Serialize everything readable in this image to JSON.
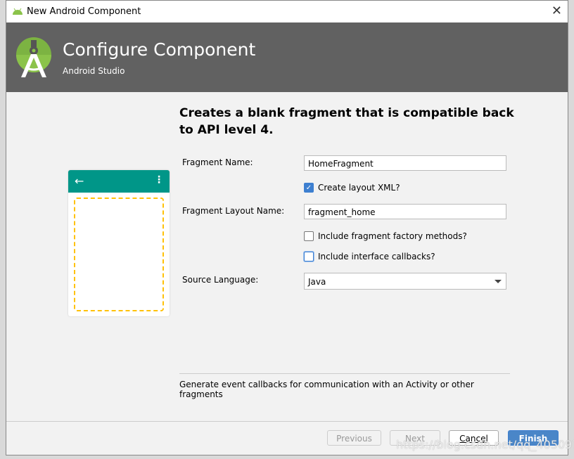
{
  "window": {
    "title": "New Android Component",
    "close": "✕"
  },
  "header": {
    "title": "Configure Component",
    "subtitle": "Android Studio"
  },
  "description": "Creates a blank fragment that is compatible back to API level 4.",
  "form": {
    "fragment_name_label": "Fragment Name:",
    "fragment_name": "HomeFragment",
    "create_layout_label": "Create layout XML?",
    "create_layout": true,
    "layout_name_label": "Fragment Layout Name:",
    "layout_name": "fragment_home",
    "factory_label": "Include fragment factory methods?",
    "factory": false,
    "callbacks_label": "Include interface callbacks?",
    "callbacks": false,
    "language_label": "Source Language:",
    "language": "Java"
  },
  "hint": "Generate event callbacks for communication with an Activity or other fragments",
  "buttons": {
    "previous": "Previous",
    "next": "Next",
    "cancel": "Cancel",
    "finish": "Finish"
  },
  "watermark": "https://blog.csdn.net/qq_40509784",
  "colors": {
    "header": "#616161",
    "accent": "#3d7fd0",
    "toolbar": "#009688",
    "dash": "#ffc107"
  }
}
